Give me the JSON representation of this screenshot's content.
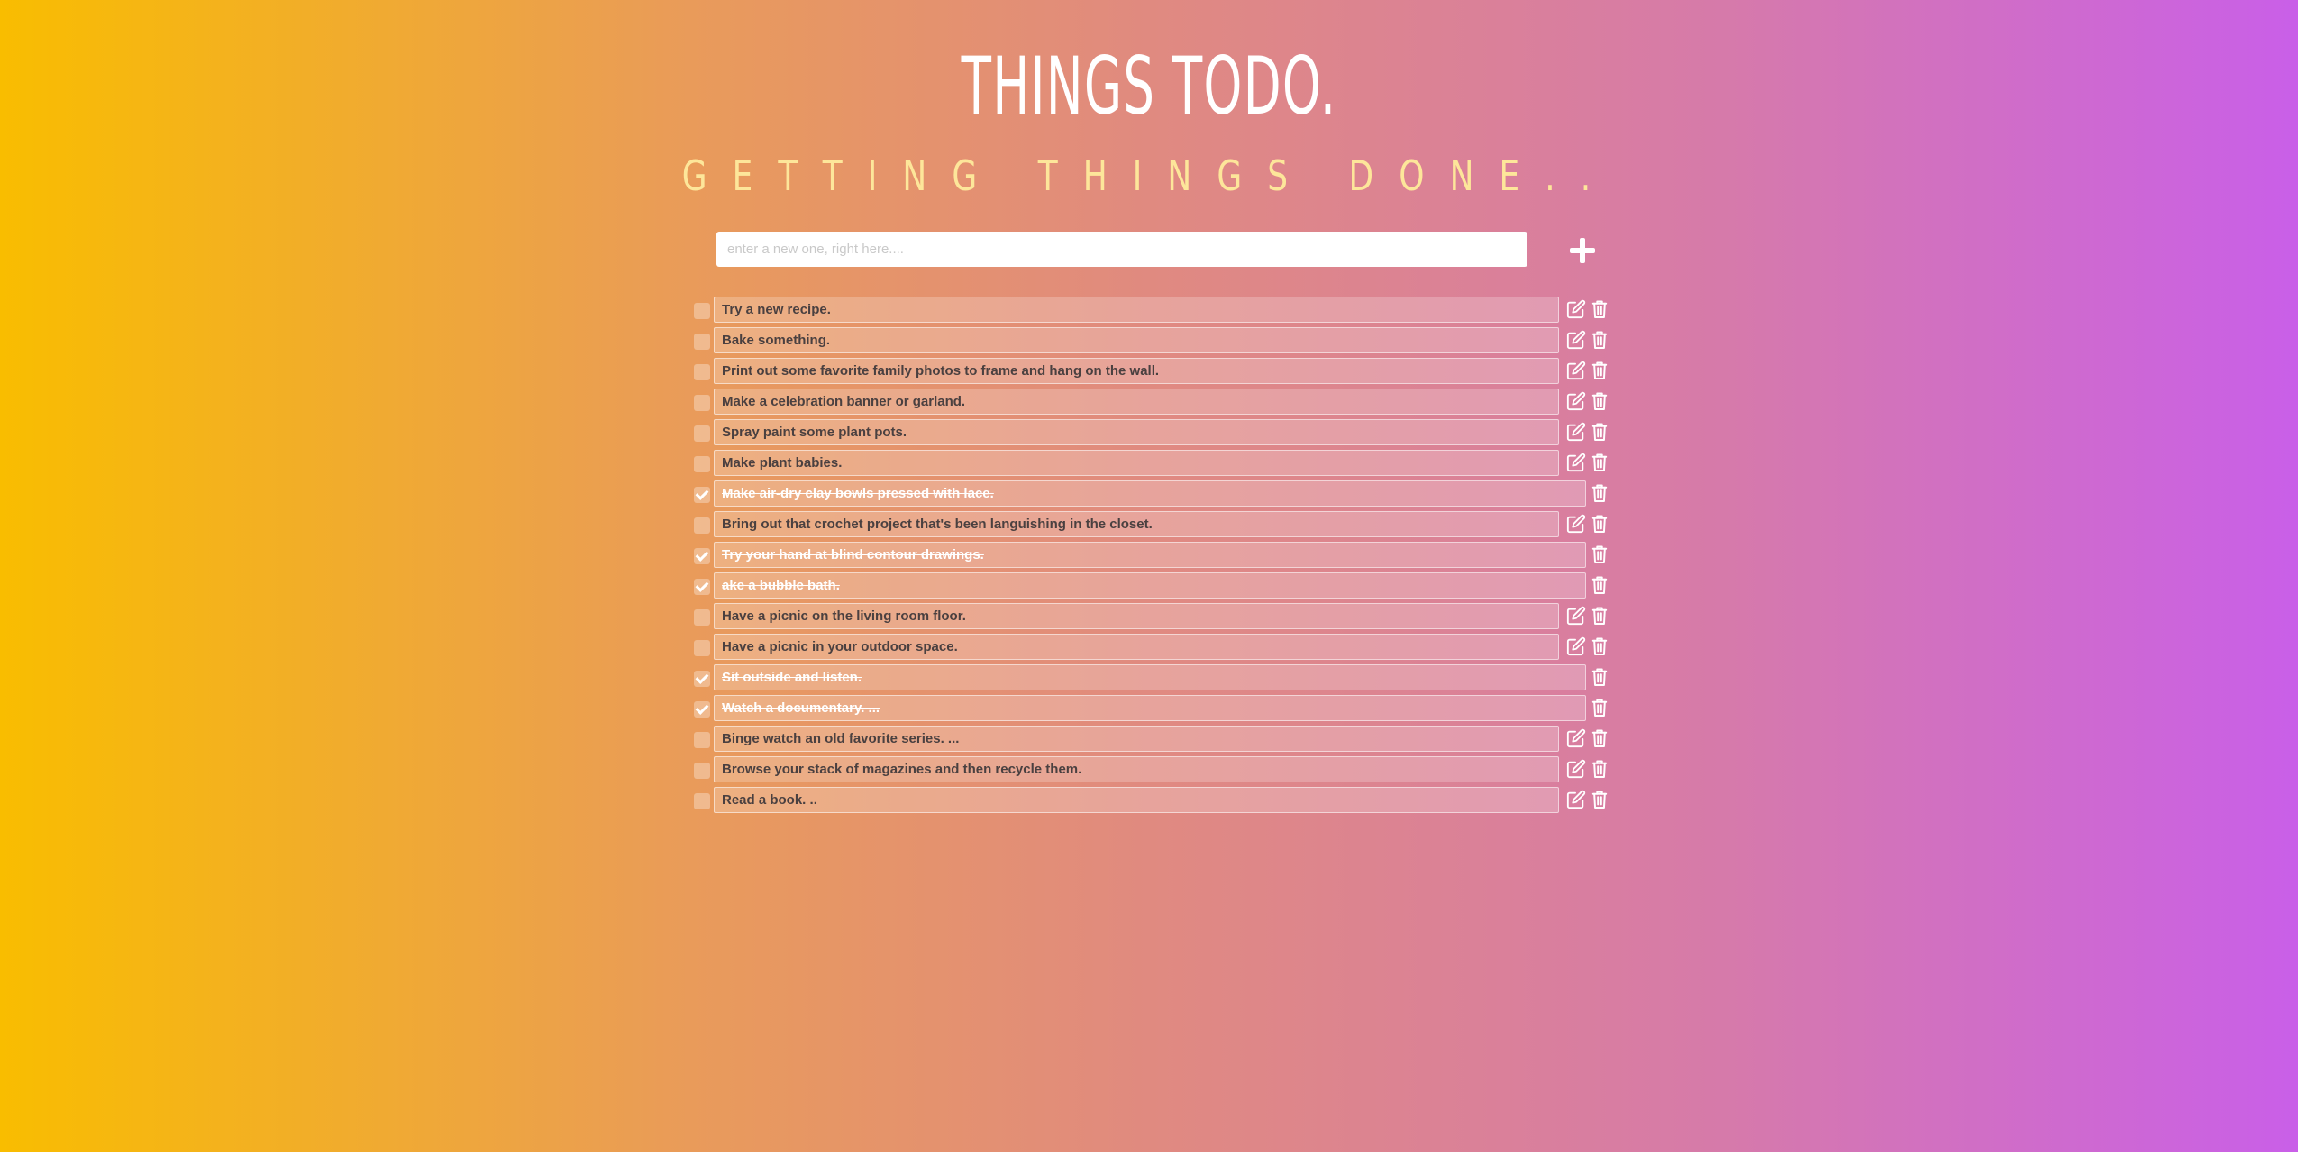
{
  "header": {
    "title": "THINGS TODO.",
    "subtitle": "GETTING THINGS DONE.."
  },
  "new_todo": {
    "placeholder": "enter a new one, right here....",
    "value": "",
    "add_icon": "plus-icon"
  },
  "todos": [
    {
      "text": "Try a new recipe.",
      "done": false
    },
    {
      "text": "Bake something.",
      "done": false
    },
    {
      "text": "Print out some favorite family photos to frame and hang on the wall.",
      "done": false
    },
    {
      "text": "Make a celebration banner or garland.",
      "done": false
    },
    {
      "text": "Spray paint some plant pots.",
      "done": false
    },
    {
      "text": "Make plant babies.",
      "done": false
    },
    {
      "text": "Make air-dry clay bowls pressed with lace.",
      "done": true
    },
    {
      "text": "Bring out that crochet project that's been languishing in the closet.",
      "done": false
    },
    {
      "text": "Try your hand at blind contour drawings.",
      "done": true
    },
    {
      "text": "ake a bubble bath.",
      "done": true
    },
    {
      "text": "Have a picnic on the living room floor.",
      "done": false
    },
    {
      "text": "Have a picnic in your outdoor space.",
      "done": false
    },
    {
      "text": "Sit outside and listen.",
      "done": true
    },
    {
      "text": "Watch a documentary. ...",
      "done": true
    },
    {
      "text": "Binge watch an old favorite series. ...",
      "done": false
    },
    {
      "text": "Browse your stack of magazines and then recycle them.",
      "done": false
    },
    {
      "text": "Read a book. ..",
      "done": false
    }
  ],
  "icons": {
    "edit": "edit-icon",
    "delete": "trash-icon",
    "checked": "checkmark-icon"
  },
  "colors": {
    "gradient_start": "#f9bd00",
    "gradient_end": "#c95fe8",
    "subtitle": "#fde69a"
  }
}
